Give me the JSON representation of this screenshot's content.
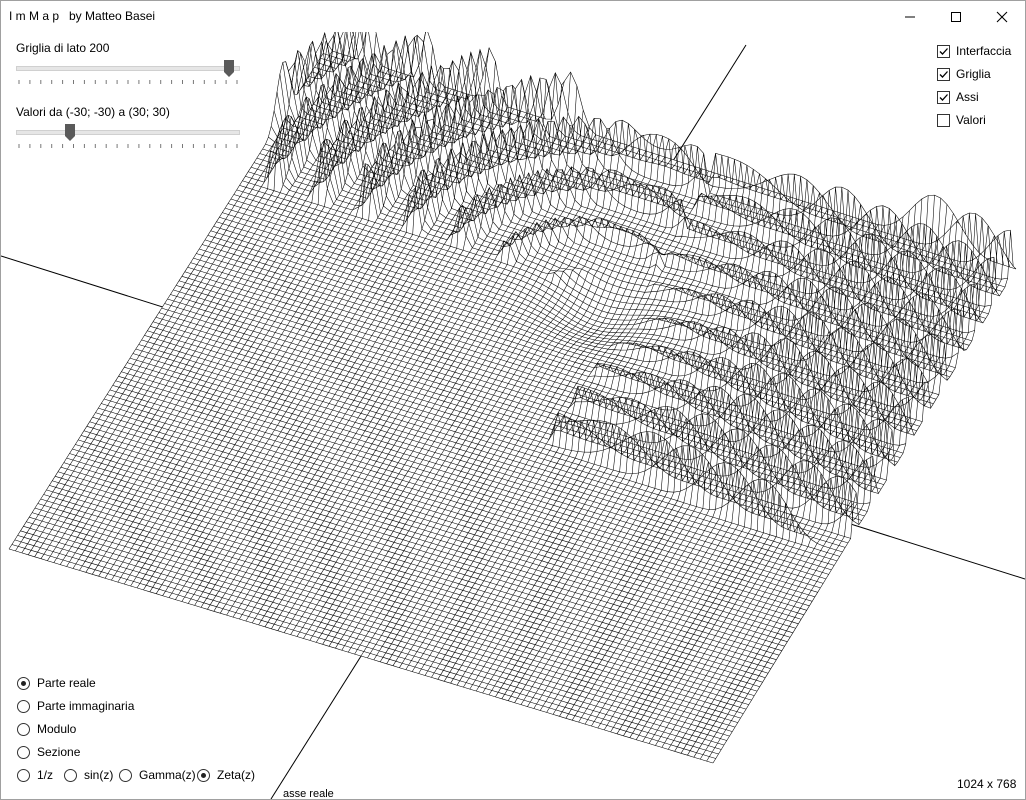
{
  "window": {
    "title": "I m M a p   by Matteo Basei"
  },
  "sliders": {
    "grid": {
      "label": "Griglia di lato 200",
      "value_fraction": 0.98,
      "tick_count": 20
    },
    "range": {
      "label": "Valori da (-30; -30) a (30; 30)",
      "value_fraction": 0.23,
      "tick_count": 20
    }
  },
  "options": {
    "interfaccia": {
      "label": "Interfaccia",
      "checked": true
    },
    "griglia": {
      "label": "Griglia",
      "checked": true
    },
    "assi": {
      "label": "Assi",
      "checked": true
    },
    "valori": {
      "label": "Valori",
      "checked": false
    }
  },
  "view_mode": {
    "parte_reale": {
      "label": "Parte reale",
      "selected": true
    },
    "parte_immaginaria": {
      "label": "Parte immaginaria",
      "selected": false
    },
    "modulo": {
      "label": "Modulo",
      "selected": false
    },
    "sezione": {
      "label": "Sezione",
      "selected": false
    }
  },
  "function": {
    "inv_z": {
      "label": "1/z",
      "selected": false
    },
    "sin_z": {
      "label": "sin(z)",
      "selected": false
    },
    "gamma_z": {
      "label": "Gamma(z)",
      "selected": false
    },
    "zeta_z": {
      "label": "Zeta(z)",
      "selected": true
    }
  },
  "status": {
    "resolution": "1024 x 768",
    "axis_label": "asse reale"
  },
  "colors": {
    "mesh_stroke": "#000000",
    "background": "#ffffff",
    "slider_thumb": "#5a5a5a"
  }
}
